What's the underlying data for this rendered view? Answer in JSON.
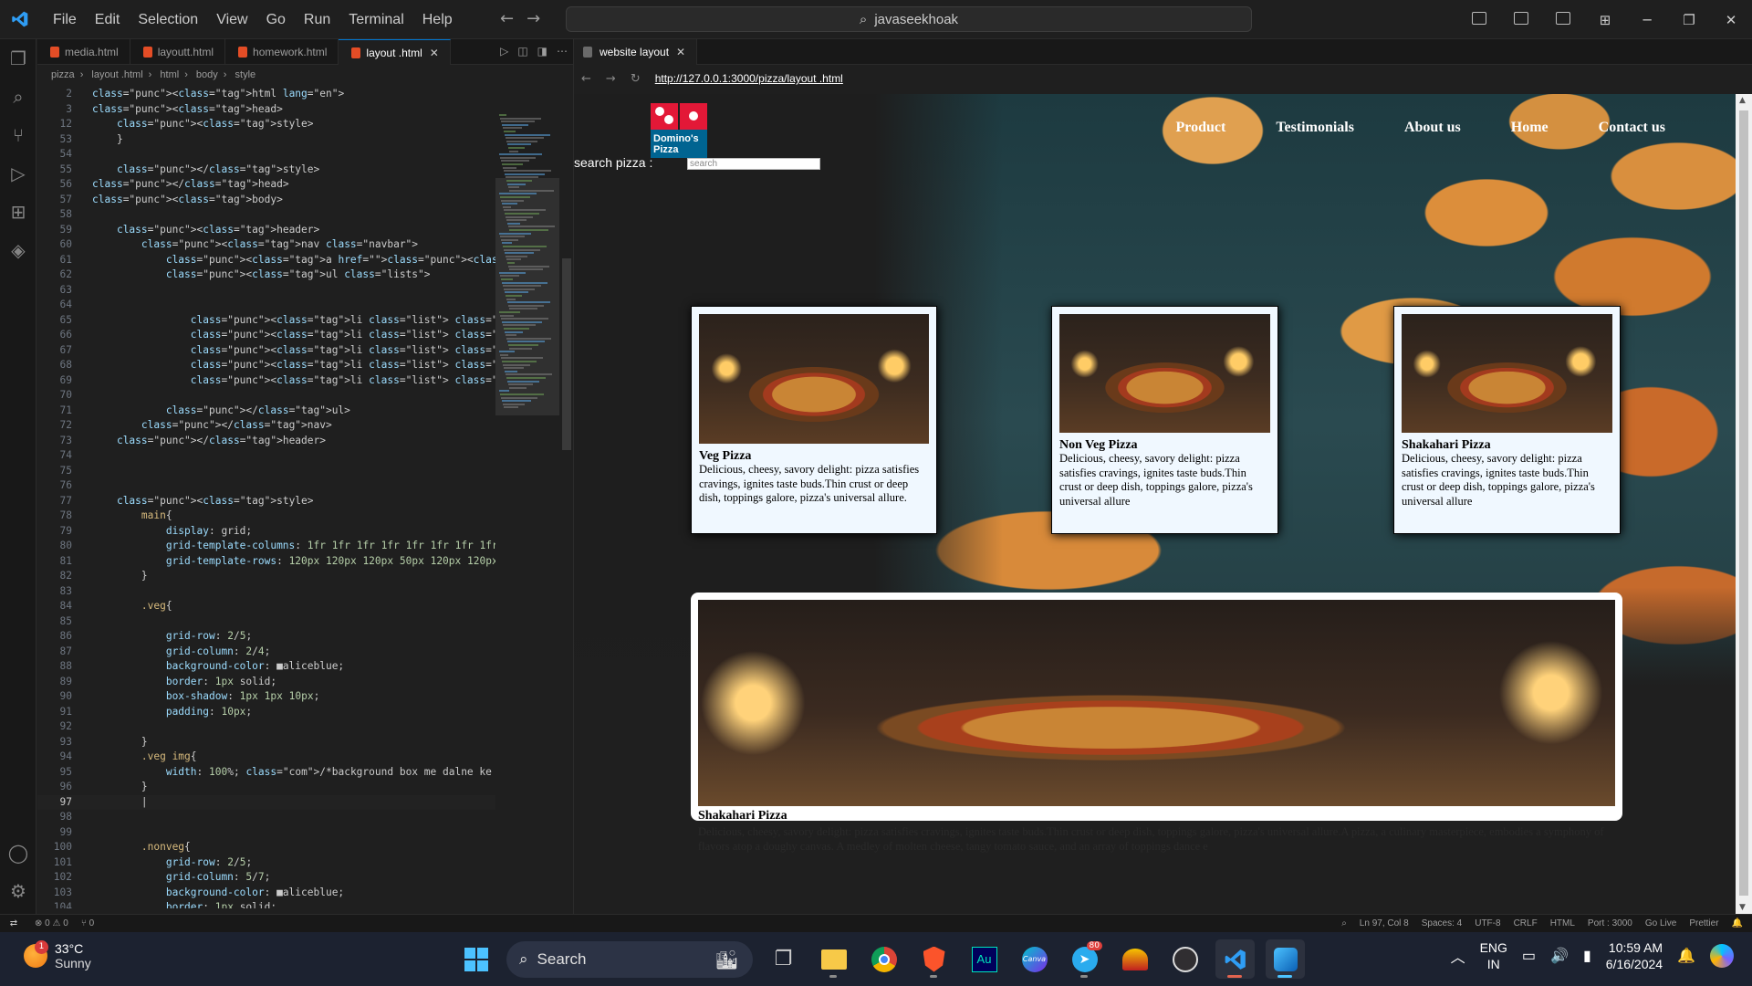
{
  "titlebar": {
    "menu": [
      "File",
      "Edit",
      "Selection",
      "View",
      "Go",
      "Run",
      "Terminal",
      "Help"
    ],
    "search": "javaseekhoak"
  },
  "editor": {
    "tabs": [
      {
        "label": "media.html",
        "active": false
      },
      {
        "label": "layoutt.html",
        "active": false
      },
      {
        "label": "homework.html",
        "active": false
      },
      {
        "label": "layout .html",
        "active": true
      }
    ],
    "breadcrumb": [
      "pizza",
      "layout .html",
      "html",
      "body",
      "style"
    ],
    "lines": [
      {
        "n": "2",
        "t": "<html lang=\"en\">"
      },
      {
        "n": "3",
        "t": "<head>"
      },
      {
        "n": "12",
        "t": "    <style>"
      },
      {
        "n": "53",
        "t": "    }"
      },
      {
        "n": "54",
        "t": ""
      },
      {
        "n": "55",
        "t": "    </style>"
      },
      {
        "n": "56",
        "t": "</head>"
      },
      {
        "n": "57",
        "t": "<body>"
      },
      {
        "n": "58",
        "t": ""
      },
      {
        "n": "59",
        "t": "    <header>"
      },
      {
        "n": "60",
        "t": "        <nav class=\"navbar\">"
      },
      {
        "n": "61",
        "t": "            <a href=\"\"><img src=\"https://imgs.search.brave.com/_xe"
      },
      {
        "n": "62",
        "t": "            <ul class=\"lists\">"
      },
      {
        "n": "63",
        "t": ""
      },
      {
        "n": "64",
        "t": ""
      },
      {
        "n": "65",
        "t": "                <li class=\"list\"> <a href=\"#\">Product</a></li>"
      },
      {
        "n": "66",
        "t": "                <li class=\"list\"> <a href=\"#\">Testimonials</a></li"
      },
      {
        "n": "67",
        "t": "                <li class=\"list\"> <a href=\"#\">About us</a></li>"
      },
      {
        "n": "68",
        "t": "                <li class=\"list\"> <a href=\"#\">Home</a></li>"
      },
      {
        "n": "69",
        "t": "                <li class=\"list\"> <a href=\"#\">Contact us</a></li>"
      },
      {
        "n": "70",
        "t": ""
      },
      {
        "n": "71",
        "t": "            </ul>"
      },
      {
        "n": "72",
        "t": "        </nav>"
      },
      {
        "n": "73",
        "t": "    </header>"
      },
      {
        "n": "74",
        "t": ""
      },
      {
        "n": "75",
        "t": ""
      },
      {
        "n": "76",
        "t": ""
      },
      {
        "n": "77",
        "t": "    <style>"
      },
      {
        "n": "78",
        "t": "        main{"
      },
      {
        "n": "79",
        "t": "            display: grid;"
      },
      {
        "n": "80",
        "t": "            grid-template-columns: 1fr 1fr 1fr 1fr 1fr 1fr 1fr 1fr"
      },
      {
        "n": "81",
        "t": "            grid-template-rows: 120px 120px 120px 50px 120px 120px"
      },
      {
        "n": "82",
        "t": "        }"
      },
      {
        "n": "83",
        "t": ""
      },
      {
        "n": "84",
        "t": "        .veg{"
      },
      {
        "n": "85",
        "t": ""
      },
      {
        "n": "86",
        "t": "            grid-row: 2/5;"
      },
      {
        "n": "87",
        "t": "            grid-column: 2/4;"
      },
      {
        "n": "88",
        "t": "            background-color: ■aliceblue;"
      },
      {
        "n": "89",
        "t": "            border: 1px solid;"
      },
      {
        "n": "90",
        "t": "            box-shadow: 1px 1px 10px;"
      },
      {
        "n": "91",
        "t": "            padding: 10px;"
      },
      {
        "n": "92",
        "t": ""
      },
      {
        "n": "93",
        "t": "        }"
      },
      {
        "n": "94",
        "t": "        .veg img{"
      },
      {
        "n": "95",
        "t": "            width: 100%; /*background box me dalne ke liye*/"
      },
      {
        "n": "96",
        "t": "        }"
      },
      {
        "n": "97",
        "t": "        |"
      },
      {
        "n": "98",
        "t": ""
      },
      {
        "n": "99",
        "t": ""
      },
      {
        "n": "100",
        "t": "        .nonveg{"
      },
      {
        "n": "101",
        "t": "            grid-row: 2/5;"
      },
      {
        "n": "102",
        "t": "            grid-column: 5/7;"
      },
      {
        "n": "103",
        "t": "            background-color: ■aliceblue;"
      },
      {
        "n": "104",
        "t": "            border: 1px solid;"
      }
    ]
  },
  "browser": {
    "tab_label": "website layout",
    "url": "http://127.0.0.1:3000/pizza/layout .html",
    "logo_text_line1": "Domino's",
    "logo_text_line2": "Pizza",
    "nav": [
      "Product",
      "Testimonials",
      "About us",
      "Home",
      "Contact us"
    ],
    "search_label": "search pizza :",
    "search_placeholder": "search",
    "cards": [
      {
        "title": "Veg Pizza",
        "desc": "Delicious, cheesy, savory delight: pizza satisfies cravings, ignites taste buds.Thin crust or deep dish, toppings galore, pizza's universal allure."
      },
      {
        "title": "Non Veg Pizza",
        "desc": "Delicious, cheesy, savory delight: pizza satisfies cravings, ignites taste buds.Thin crust or deep dish, toppings galore, pizza's universal allure"
      },
      {
        "title": "Shakahari Pizza",
        "desc": "Delicious, cheesy, savory delight: pizza satisfies cravings, ignites taste buds.Thin crust or deep dish, toppings galore, pizza's universal allure"
      }
    ],
    "big_card": {
      "title": "Shakahari Pizza",
      "desc": "Delicious, cheesy, savory delight: pizza satisfies cravings, ignites taste buds.Thin crust or deep dish, toppings galore, pizza's universal allure.A pizza, a culinary masterpiece, embodies a symphony of flavors atop a doughy canvas. A medley of molten cheese, tangy tomato sauce, and an array of toppings dance e"
    }
  },
  "statusbar": {
    "problems": "⊗ 0 ⚠ 0",
    "ports": "⑂ 0",
    "right": [
      "Ln 97, Col 8",
      "Spaces: 4",
      "UTF-8",
      "CRLF",
      "HTML",
      "Port : 3000",
      "Go Live",
      "Prettier"
    ]
  },
  "taskbar": {
    "temp": "33°C",
    "condition": "Sunny",
    "weather_badge": "1",
    "search": "Search",
    "telegram_badge": "80",
    "lang1": "ENG",
    "lang2": "IN",
    "time": "10:59 AM",
    "date": "6/16/2024"
  },
  "colors": {
    "accent": "#0078d4",
    "editor_bg": "#1f1f1f",
    "card_bg": "#f0f8ff",
    "taskbar_bg": "#1c2230"
  }
}
